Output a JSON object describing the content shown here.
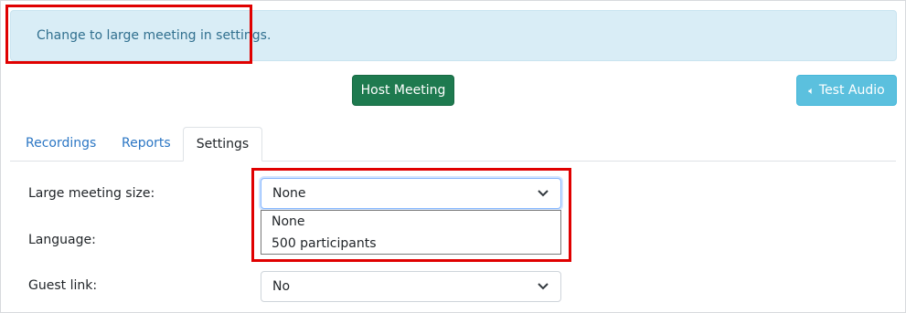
{
  "alert": {
    "message": "Change to large meeting in settings."
  },
  "actions": {
    "host_label": "Host Meeting",
    "test_audio_label": "Test Audio",
    "test_audio_icon": "speaker-icon"
  },
  "tabs": [
    {
      "label": "Recordings",
      "active": false
    },
    {
      "label": "Reports",
      "active": false
    },
    {
      "label": "Settings",
      "active": true
    }
  ],
  "settings": {
    "large_meeting_size": {
      "label": "Large meeting size:",
      "value": "None",
      "options": [
        "None",
        "500 participants"
      ],
      "expanded": true
    },
    "language": {
      "label": "Language:"
    },
    "guest_link": {
      "label": "Guest link:",
      "value": "No"
    }
  },
  "colors": {
    "alert_bg": "#d9edf6",
    "alert_text": "#31708f",
    "host_button": "#1e7a4f",
    "test_audio_button": "#5bc0de",
    "tab_link": "#2b76c4",
    "highlight": "#e00000"
  }
}
